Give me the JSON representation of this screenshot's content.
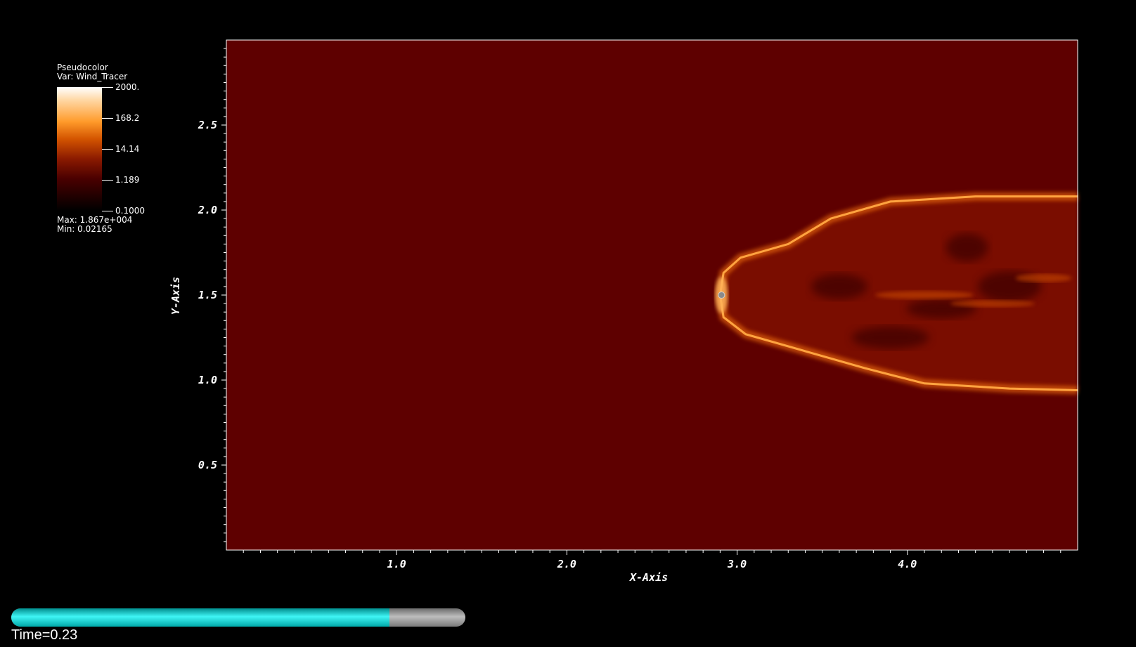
{
  "legend": {
    "plot_type": "Pseudocolor",
    "var": "Var: Wind_Tracer",
    "ticks": [
      "2000.",
      "168.2",
      "14.14",
      "1.189",
      "0.1000"
    ],
    "max": "Max:  1.867e+004",
    "min": "Min:  0.02165"
  },
  "time_label": "Time=0.23",
  "progress": 0.833,
  "colors": {
    "background_field": "#5e0000",
    "progress_fill": "#1de8e8",
    "progress_track": "#9a9a9a"
  },
  "chart_data": {
    "type": "heatmap",
    "xlabel": "X-Axis",
    "ylabel": "Y-Axis",
    "xlim": [
      0.0,
      5.0
    ],
    "ylim": [
      0.0,
      3.0
    ],
    "x_ticks": [
      {
        "value": 1.0,
        "label": "1.0"
      },
      {
        "value": 2.0,
        "label": "2.0"
      },
      {
        "value": 3.0,
        "label": "3.0"
      },
      {
        "value": 4.0,
        "label": "4.0"
      }
    ],
    "y_ticks": [
      {
        "value": 0.5,
        "label": "0.5"
      },
      {
        "value": 1.0,
        "label": "1.0"
      },
      {
        "value": 1.5,
        "label": "1.5"
      },
      {
        "value": 2.0,
        "label": "2.0"
      },
      {
        "value": 2.5,
        "label": "2.5"
      }
    ],
    "star_position": [
      2.9,
      1.5
    ],
    "bow_shock": {
      "upper_outer": [
        [
          2.9,
          1.5
        ],
        [
          2.92,
          1.63
        ],
        [
          3.02,
          1.72
        ],
        [
          3.3,
          1.8
        ],
        [
          3.55,
          1.95
        ],
        [
          3.9,
          2.05
        ],
        [
          4.4,
          2.08
        ],
        [
          5.0,
          2.08
        ]
      ],
      "lower_outer": [
        [
          2.9,
          1.5
        ],
        [
          2.92,
          1.37
        ],
        [
          3.05,
          1.27
        ],
        [
          3.4,
          1.17
        ],
        [
          3.75,
          1.07
        ],
        [
          4.1,
          0.98
        ],
        [
          4.6,
          0.95
        ],
        [
          5.0,
          0.94
        ]
      ]
    },
    "colorscale": {
      "name": "hot",
      "min": 0.1,
      "max": 2000.0,
      "scale": "log"
    }
  }
}
